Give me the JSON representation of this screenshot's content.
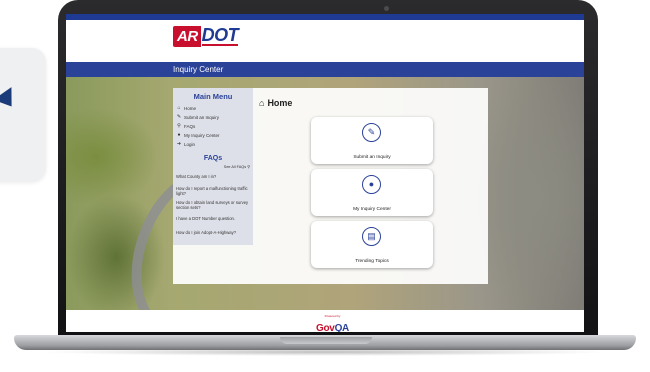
{
  "brand": {
    "logo_ar": "AR",
    "logo_dot": "DOT"
  },
  "header": {
    "bar_title": "Inquiry Center"
  },
  "menu": {
    "title": "Main Menu",
    "items": [
      {
        "label": "Home",
        "icon": "home-icon",
        "glyph": "⌂"
      },
      {
        "label": "Submit an Inquiry",
        "icon": "edit-icon",
        "glyph": "✎"
      },
      {
        "label": "FAQs",
        "icon": "search-icon",
        "glyph": "⚲"
      },
      {
        "label": "My Inquiry Center",
        "icon": "user-icon",
        "glyph": "●"
      },
      {
        "label": "Login",
        "icon": "login-icon",
        "glyph": "➜"
      }
    ]
  },
  "faqs": {
    "title": "FAQs",
    "see_all": "See All FAQs",
    "items": [
      "What County am I in?",
      "How do I report a malfunctioning traffic light?",
      "How do I obtain land surveys or survey section sets?",
      "I have a DOT Number question.",
      "How do I join Adopt-A-Highway?"
    ]
  },
  "main": {
    "page_title": "Home",
    "tiles": [
      {
        "label": "Submit an Inquiry",
        "icon": "edit-icon",
        "glyph": "✎"
      },
      {
        "label": "My Inquiry Center",
        "icon": "user-icon",
        "glyph": "●"
      },
      {
        "label": "Trending Topics",
        "icon": "list-icon",
        "glyph": "▤"
      }
    ]
  },
  "footer": {
    "powered_by": "Powered by",
    "govqa_gov": "Gov",
    "govqa_qa": "QA"
  },
  "colors": {
    "brand_blue": "#2b4299",
    "brand_red": "#c8102e"
  }
}
